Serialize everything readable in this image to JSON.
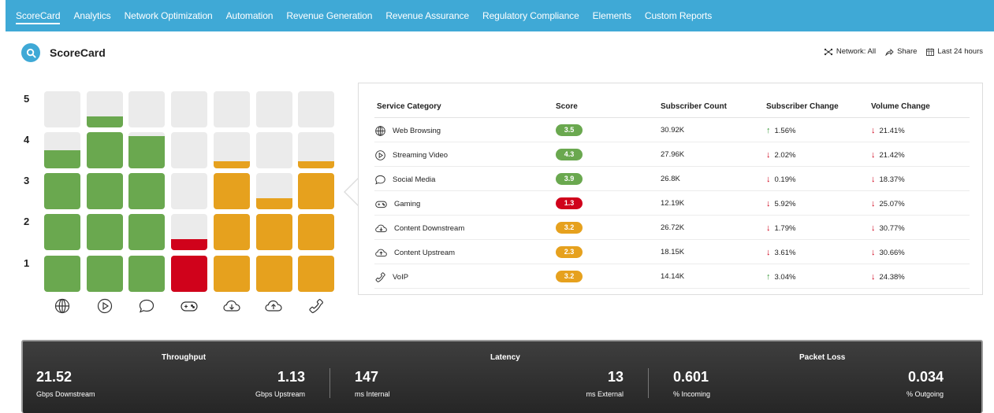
{
  "nav": {
    "items": [
      "ScoreCard",
      "Analytics",
      "Network Optimization",
      "Automation",
      "Revenue Generation",
      "Revenue Assurance",
      "Regulatory Compliance",
      "Elements",
      "Custom Reports"
    ],
    "active": "ScoreCard"
  },
  "header": {
    "title": "ScoreCard",
    "icon": "search-icon",
    "network_label": "Network: All",
    "share_label": "Share",
    "time_label": "Last 24 hours"
  },
  "colors": {
    "nav": "#3fa9d6",
    "good": "#6aa84f",
    "warning": "#e6a11e",
    "bad": "#d0021b",
    "empty": "#ebebeb",
    "up_arrow": "#3a9a3a",
    "down_arrow": "#d0021b"
  },
  "grid": {
    "row_labels": [
      "5",
      "4",
      "3",
      "2",
      "1"
    ],
    "columns": [
      {
        "icon": "globe-icon",
        "score": 3.5,
        "level": "good"
      },
      {
        "icon": "play-circle-icon",
        "score": 4.3,
        "level": "good"
      },
      {
        "icon": "chat-bubble-icon",
        "score": 3.9,
        "level": "good"
      },
      {
        "icon": "gamepad-icon",
        "score": 1.3,
        "level": "bad"
      },
      {
        "icon": "cloud-download-icon",
        "score": 3.2,
        "level": "warning"
      },
      {
        "icon": "cloud-upload-icon",
        "score": 2.3,
        "level": "warning"
      },
      {
        "icon": "phone-icon",
        "score": 3.2,
        "level": "warning"
      }
    ]
  },
  "table": {
    "headers": [
      "Service Category",
      "Score",
      "Subscriber Count",
      "Subscriber Change",
      "Volume Change"
    ],
    "rows": [
      {
        "category": "Web Browsing",
        "icon": "globe-icon",
        "score": "3.5",
        "level": "good",
        "subscribers": "30.92K",
        "sub_change": "1.56%",
        "sub_dir": "up",
        "vol_change": "21.41%",
        "vol_dir": "down"
      },
      {
        "category": "Streaming Video",
        "icon": "play-circle-icon",
        "score": "4.3",
        "level": "good",
        "subscribers": "27.96K",
        "sub_change": "2.02%",
        "sub_dir": "down",
        "vol_change": "21.42%",
        "vol_dir": "down"
      },
      {
        "category": "Social Media",
        "icon": "chat-bubble-icon",
        "score": "3.9",
        "level": "good",
        "subscribers": "26.8K",
        "sub_change": "0.19%",
        "sub_dir": "down",
        "vol_change": "18.37%",
        "vol_dir": "down"
      },
      {
        "category": "Gaming",
        "icon": "gamepad-icon",
        "score": "1.3",
        "level": "bad",
        "subscribers": "12.19K",
        "sub_change": "5.92%",
        "sub_dir": "down",
        "vol_change": "25.07%",
        "vol_dir": "down"
      },
      {
        "category": "Content Downstream",
        "icon": "cloud-download-icon",
        "score": "3.2",
        "level": "warning",
        "subscribers": "26.72K",
        "sub_change": "1.79%",
        "sub_dir": "down",
        "vol_change": "30.77%",
        "vol_dir": "down"
      },
      {
        "category": "Content Upstream",
        "icon": "cloud-upload-icon",
        "score": "2.3",
        "level": "warning",
        "subscribers": "18.15K",
        "sub_change": "3.61%",
        "sub_dir": "down",
        "vol_change": "30.66%",
        "vol_dir": "down"
      },
      {
        "category": "VoIP",
        "icon": "phone-icon",
        "score": "3.2",
        "level": "warning",
        "subscribers": "14.14K",
        "sub_change": "3.04%",
        "sub_dir": "up",
        "vol_change": "24.38%",
        "vol_dir": "down"
      }
    ]
  },
  "metrics": {
    "throughput": {
      "title": "Throughput",
      "left_value": "21.52",
      "left_label": "Gbps Downstream",
      "right_value": "1.13",
      "right_label": "Gbps Upstream"
    },
    "latency": {
      "title": "Latency",
      "left_value": "147",
      "left_label": "ms Internal",
      "right_value": "13",
      "right_label": "ms External"
    },
    "packet_loss": {
      "title": "Packet Loss",
      "left_value": "0.601",
      "left_label": "% Incoming",
      "right_value": "0.034",
      "right_label": "% Outgoing"
    }
  }
}
